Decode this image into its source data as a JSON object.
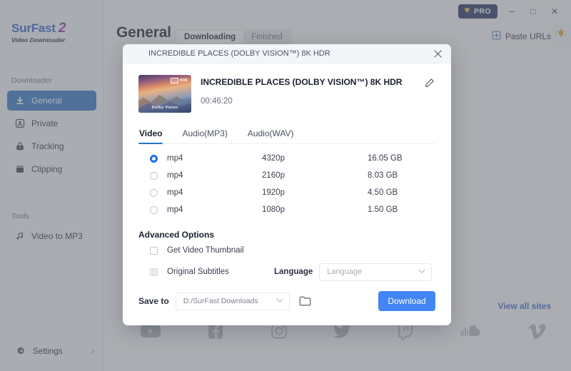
{
  "app": {
    "logo_primary": "SurFast",
    "logo_accent": "2",
    "logo_subtitle": "Video Downloader"
  },
  "titlebar": {
    "pro_label": "PRO",
    "pro_icon": "diamond-icon",
    "pro_color": "#232e63",
    "minimize": "─",
    "maximize": "□",
    "close": "✕"
  },
  "sidebar": {
    "group_downloader": "Downloader",
    "group_tools": "Tools",
    "items": [
      {
        "label": "General",
        "icon": "download-arrow-icon",
        "active": true
      },
      {
        "label": "Private",
        "icon": "private-user-icon",
        "active": false
      },
      {
        "label": "Tracking",
        "icon": "lock-icon",
        "active": false
      },
      {
        "label": "Clipping",
        "icon": "film-strip-icon",
        "active": false
      }
    ],
    "tools": [
      {
        "label": "Video to MP3",
        "icon": "music-note-icon"
      }
    ],
    "settings_label": "Settings",
    "settings_icon": "gear-icon",
    "settings_chevron": "›",
    "accent_active": "#2b72c4"
  },
  "header": {
    "page_title": "General",
    "tabs": [
      {
        "label": "Downloading",
        "active": true
      },
      {
        "label": "Finished",
        "active": false
      }
    ],
    "paste_urls_label": "Paste URLs",
    "paste_urls_icon": "plus-box-icon",
    "bulb_icon": "lightbulb-icon",
    "bulb_color": "#d99b1c"
  },
  "background": {
    "view_all_sites": "View all sites",
    "link_color": "#2f5fd0",
    "site_icons": [
      "youtube-icon",
      "facebook-icon",
      "instagram-icon",
      "twitter-icon",
      "twitch-icon",
      "soundcloud-icon",
      "vimeo-icon"
    ]
  },
  "modal": {
    "header_title": "INCREDIBLE PLACES (DOLBY VISION™) 8K HDR",
    "close_icon": "close-icon",
    "video": {
      "title": "INCREDIBLE PLACES (DOLBY VISION™) 8K HDR",
      "duration": "00:46:20",
      "thumbnail_badge": "HDR",
      "thumbnail_brand": "Dolby Vision",
      "edit_icon": "pencil-icon"
    },
    "format_tabs": [
      {
        "label": "Video",
        "active": true
      },
      {
        "label": "Audio(MP3)",
        "active": false
      },
      {
        "label": "Audio(WAV)",
        "active": false
      }
    ],
    "qualities": [
      {
        "format": "mp4",
        "resolution": "4320p",
        "size": "16.05 GB",
        "selected": true
      },
      {
        "format": "mp4",
        "resolution": "2160p",
        "size": "8.03 GB",
        "selected": false
      },
      {
        "format": "mp4",
        "resolution": "1920p",
        "size": "4.50 GB",
        "selected": false
      },
      {
        "format": "mp4",
        "resolution": "1080p",
        "size": "1.50 GB",
        "selected": false
      }
    ],
    "advanced": {
      "title": "Advanced Options",
      "thumbnail_option": {
        "label": "Get Video Thumbnail",
        "checked": false,
        "disabled": false
      },
      "subtitles_option": {
        "label": "Original Subtitles",
        "checked": false,
        "disabled": true
      },
      "language_label": "Language",
      "language_placeholder": "Language",
      "language_value": ""
    },
    "footer": {
      "save_to_label": "Save to",
      "save_path": "D:/SurFast Downloads",
      "folder_icon": "folder-icon",
      "download_label": "Download",
      "download_color": "#4285f4"
    }
  }
}
